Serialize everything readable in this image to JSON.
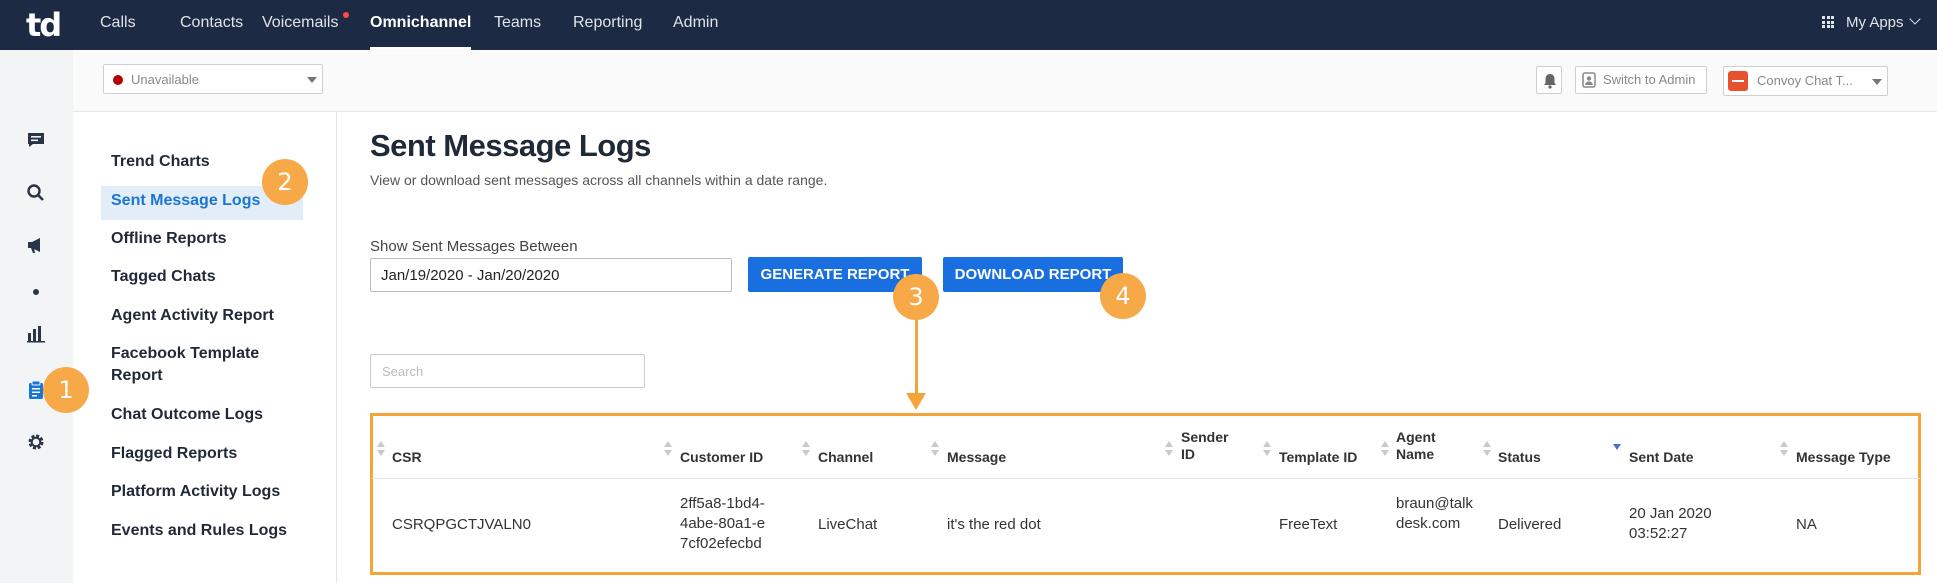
{
  "topnav": {
    "logo": "td",
    "items": [
      {
        "label": "Calls",
        "active": false
      },
      {
        "label": "Contacts",
        "active": false
      },
      {
        "label": "Voicemails",
        "active": false,
        "notification_dot": true
      },
      {
        "label": "Omnichannel",
        "active": true
      },
      {
        "label": "Teams",
        "active": false
      },
      {
        "label": "Reporting",
        "active": false
      },
      {
        "label": "Admin",
        "active": false
      }
    ],
    "my_apps": "My Apps"
  },
  "rail": {
    "icons": [
      "chat-icon",
      "search-icon",
      "megaphone-icon",
      "dot-icon",
      "bar-chart-icon",
      "clipboard-icon",
      "gear-icon"
    ],
    "active_icon": "clipboard-icon",
    "active_color": "#1976d2"
  },
  "subbar": {
    "status": "Unavailable",
    "status_color": "#b30000",
    "switch_admin": "Switch to Admin",
    "account": "Convoy Chat T..."
  },
  "sidemenu": {
    "items": [
      {
        "label": "Trend Charts",
        "active": false
      },
      {
        "label": "Sent Message Logs",
        "active": true
      },
      {
        "label": "Offline Reports",
        "active": false
      },
      {
        "label": "Tagged Chats",
        "active": false
      },
      {
        "label": "Agent Activity Report",
        "active": false
      },
      {
        "label": "Facebook Template Report",
        "active": false
      },
      {
        "label": "Chat Outcome Logs",
        "active": false
      },
      {
        "label": "Flagged Reports",
        "active": false
      },
      {
        "label": "Platform Activity Logs",
        "active": false
      },
      {
        "label": "Events and Rules Logs",
        "active": false
      }
    ]
  },
  "main": {
    "title": "Sent Message Logs",
    "subtitle": "View or download sent messages across all channels within a date range.",
    "range_label": "Show Sent Messages Between",
    "range_value": "Jan/19/2020 - Jan/20/2020",
    "generate_label": "GENERATE REPORT",
    "download_label": "DOWNLOAD REPORT",
    "search_placeholder": "Search"
  },
  "table": {
    "columns": [
      "CSR",
      "Customer ID",
      "Channel",
      "Message",
      "Sender ID",
      "Template ID",
      "Agent Name",
      "Status",
      "Sent Date",
      "Message Type"
    ],
    "sorted_column": "Sent Date",
    "sort_direction": "desc",
    "rows": [
      {
        "csr": "CSRQPGCTJVALN0",
        "customer_id": "2ff5a8-1bd4-4abe-80a1-e7cf02efecbd",
        "channel": "LiveChat",
        "message": "it's the red dot",
        "sender_id": "",
        "template_id": "FreeText",
        "agent_name": "braun@talkdesk.com",
        "status": "Delivered",
        "sent_date": "20 Jan 2020 03:52:27",
        "message_type": "NA"
      }
    ]
  },
  "callouts": [
    "1",
    "2",
    "3",
    "4"
  ],
  "accent_color": "#f5a43a",
  "primary_color": "#1a6fe0"
}
